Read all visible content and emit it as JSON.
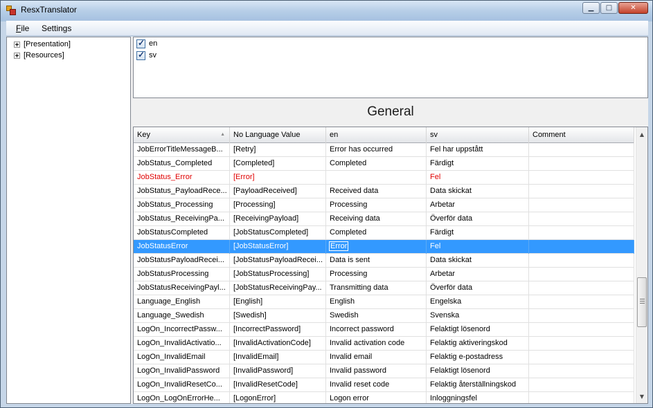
{
  "window": {
    "title": "ResxTranslator"
  },
  "menu": {
    "file": "File",
    "file_rest": "ile",
    "file_accel": "F",
    "settings": "Settings"
  },
  "tree": {
    "items": [
      {
        "label": "[Presentation]"
      },
      {
        "label": "[Resources]"
      }
    ]
  },
  "languages": [
    {
      "code": "en",
      "checked": true
    },
    {
      "code": "sv",
      "checked": true
    }
  ],
  "section": {
    "title": "General"
  },
  "grid": {
    "columns": [
      "Key",
      "No Language Value",
      "en",
      "sv",
      "Comment"
    ],
    "rows": [
      {
        "key": "JobErrorTitleMessageB...",
        "nolang": "[Retry]",
        "en": "Error has occurred",
        "sv": "Fel har uppstått",
        "comment": "",
        "state": ""
      },
      {
        "key": "JobStatus_Completed",
        "nolang": "[Completed]",
        "en": "Completed",
        "sv": "Färdigt",
        "comment": "",
        "state": ""
      },
      {
        "key": "JobStatus_Error",
        "nolang": "[Error]",
        "en": "",
        "sv": "Fel",
        "comment": "",
        "state": "error"
      },
      {
        "key": "JobStatus_PayloadRece...",
        "nolang": "[PayloadReceived]",
        "en": "Received data",
        "sv": "Data skickat",
        "comment": "",
        "state": ""
      },
      {
        "key": "JobStatus_Processing",
        "nolang": "[Processing]",
        "en": "Processing",
        "sv": "Arbetar",
        "comment": "",
        "state": ""
      },
      {
        "key": "JobStatus_ReceivingPa...",
        "nolang": "[ReceivingPayload]",
        "en": "Receiving data",
        "sv": "Överför data",
        "comment": "",
        "state": ""
      },
      {
        "key": "JobStatusCompleted",
        "nolang": "[JobStatusCompleted]",
        "en": "Completed",
        "sv": "Färdigt",
        "comment": "",
        "state": ""
      },
      {
        "key": "JobStatusError",
        "nolang": "[JobStatusError]",
        "en": "Error",
        "sv": "Fel",
        "comment": "",
        "state": "selected"
      },
      {
        "key": "JobStatusPayloadRecei...",
        "nolang": "[JobStatusPayloadRecei...",
        "en": "Data is sent",
        "sv": "Data skickat",
        "comment": "",
        "state": ""
      },
      {
        "key": "JobStatusProcessing",
        "nolang": "[JobStatusProcessing]",
        "en": "Processing",
        "sv": "Arbetar",
        "comment": "",
        "state": ""
      },
      {
        "key": "JobStatusReceivingPayl...",
        "nolang": "[JobStatusReceivingPay...",
        "en": "Transmitting data",
        "sv": "Överför data",
        "comment": "",
        "state": ""
      },
      {
        "key": "Language_English",
        "nolang": "[English]",
        "en": "English",
        "sv": "Engelska",
        "comment": "",
        "state": ""
      },
      {
        "key": "Language_Swedish",
        "nolang": "[Swedish]",
        "en": "Swedish",
        "sv": "Svenska",
        "comment": "",
        "state": ""
      },
      {
        "key": "LogOn_IncorrectPassw...",
        "nolang": "[IncorrectPassword]",
        "en": "Incorrect password",
        "sv": "Felaktigt lösenord",
        "comment": "",
        "state": ""
      },
      {
        "key": "LogOn_InvalidActivatio...",
        "nolang": "[InvalidActivationCode]",
        "en": "Invalid activation code",
        "sv": "Felaktig aktiveringskod",
        "comment": "",
        "state": ""
      },
      {
        "key": "LogOn_InvalidEmail",
        "nolang": "[InvalidEmail]",
        "en": "Invalid email",
        "sv": "Felaktig e-postadress",
        "comment": "",
        "state": ""
      },
      {
        "key": "LogOn_InvalidPassword",
        "nolang": "[InvalidPassword]",
        "en": "Invalid password",
        "sv": "Felaktigt lösenord",
        "comment": "",
        "state": ""
      },
      {
        "key": "LogOn_InvalidResetCo...",
        "nolang": "[InvalidResetCode]",
        "en": "Invalid reset code",
        "sv": "Felaktig återställningskod",
        "comment": "",
        "state": ""
      },
      {
        "key": "LogOn_LogOnErrorHe...",
        "nolang": "[LogonError]",
        "en": "Logon error",
        "sv": "Inloggningsfel",
        "comment": "",
        "state": ""
      }
    ]
  },
  "colors": {
    "selection": "#3399ff",
    "error_text": "#e00000"
  }
}
